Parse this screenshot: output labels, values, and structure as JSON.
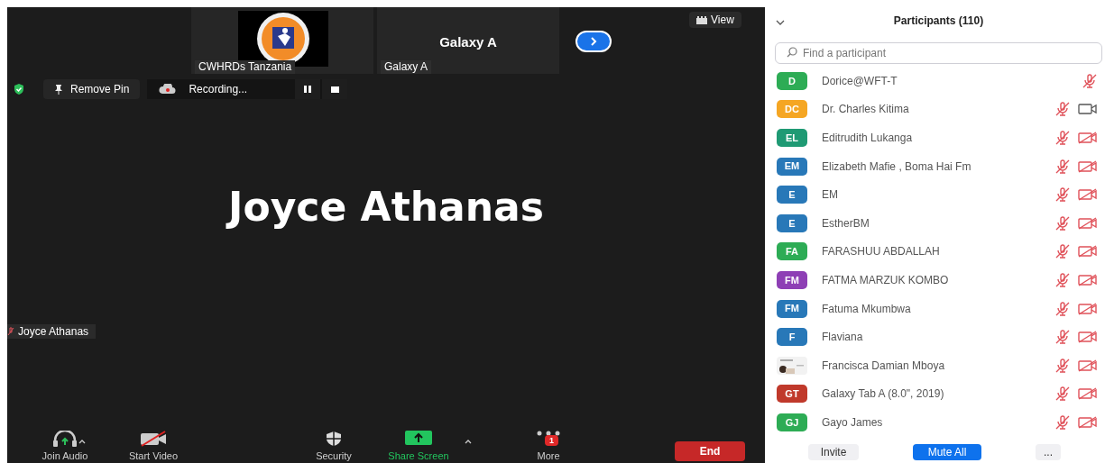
{
  "thumbnails": [
    {
      "kind": "picture",
      "label": "CWHRDs Tanzania"
    },
    {
      "kind": "name",
      "title": "Galaxy A",
      "label": "Galaxy A"
    }
  ],
  "view_button": "View",
  "pin_button": "Remove Pin",
  "recording": {
    "label": "Recording...",
    "paused": false
  },
  "speaker": {
    "name": "Joyce Athanas",
    "tag": "Joyce Athanas",
    "muted": true
  },
  "toolbar": [
    {
      "kind": "audio",
      "label": "Join Audio",
      "caret": true
    },
    {
      "kind": "video",
      "label": "Start Video",
      "caret": false
    },
    {
      "kind": "security",
      "label": "Security",
      "caret": false
    },
    {
      "kind": "share",
      "label": "Share Screen",
      "caret": true
    },
    {
      "kind": "more",
      "label": "More",
      "caret": false,
      "badge": "1"
    }
  ],
  "end_button": "End",
  "participants": {
    "title": "Participants (110)",
    "search": {
      "placeholder": "Find a participant"
    },
    "items": [
      {
        "initials": "D",
        "color": "#2dac55",
        "name": "Dorice@WFT-T",
        "mic_muted": true
      },
      {
        "initials": "DC",
        "color": "#f5a623",
        "name": "Dr. Charles Kitima",
        "mic_muted": true,
        "video_off": false
      },
      {
        "initials": "EL",
        "color": "#1f9a74",
        "name": "Editrudith Lukanga",
        "mic_muted": true,
        "video_off": true
      },
      {
        "initials": "EM",
        "color": "#2878b8",
        "name": "Elizabeth Mafie , Boma Hai Fm",
        "mic_muted": true,
        "video_off": true
      },
      {
        "initials": "E",
        "color": "#2878b8",
        "name": "EM",
        "mic_muted": true,
        "video_off": true
      },
      {
        "initials": "E",
        "color": "#2878b8",
        "name": "EstherBM",
        "mic_muted": true,
        "video_off": true
      },
      {
        "initials": "FA",
        "color": "#2dac55",
        "name": "FARASHUU ABDALLAH",
        "mic_muted": true,
        "video_off": true
      },
      {
        "initials": "FM",
        "color": "#8e3fb5",
        "name": "FATMA MARZUK KOMBO",
        "mic_muted": true,
        "video_off": true
      },
      {
        "initials": "FM",
        "color": "#2878b8",
        "name": "Fatuma Mkumbwa",
        "mic_muted": true,
        "video_off": true
      },
      {
        "initials": "F",
        "color": "#2878b8",
        "name": "Flaviana",
        "mic_muted": true,
        "video_off": true
      },
      {
        "kind": "picture",
        "name": "Francisca Damian Mboya",
        "mic_muted": true,
        "video_off": true
      },
      {
        "initials": "GT",
        "color": "#c0392b",
        "name": "Galaxy Tab A (8.0\", 2019)",
        "mic_muted": true,
        "video_off": true
      },
      {
        "initials": "GJ",
        "color": "#2dac55",
        "name": "Gayo James",
        "mic_muted": true,
        "video_off": true
      }
    ],
    "buttons": [
      {
        "kind": "plain",
        "label": "Invite"
      },
      {
        "kind": "primary",
        "label": "Mute All"
      },
      {
        "kind": "plain",
        "label": "..."
      }
    ]
  }
}
